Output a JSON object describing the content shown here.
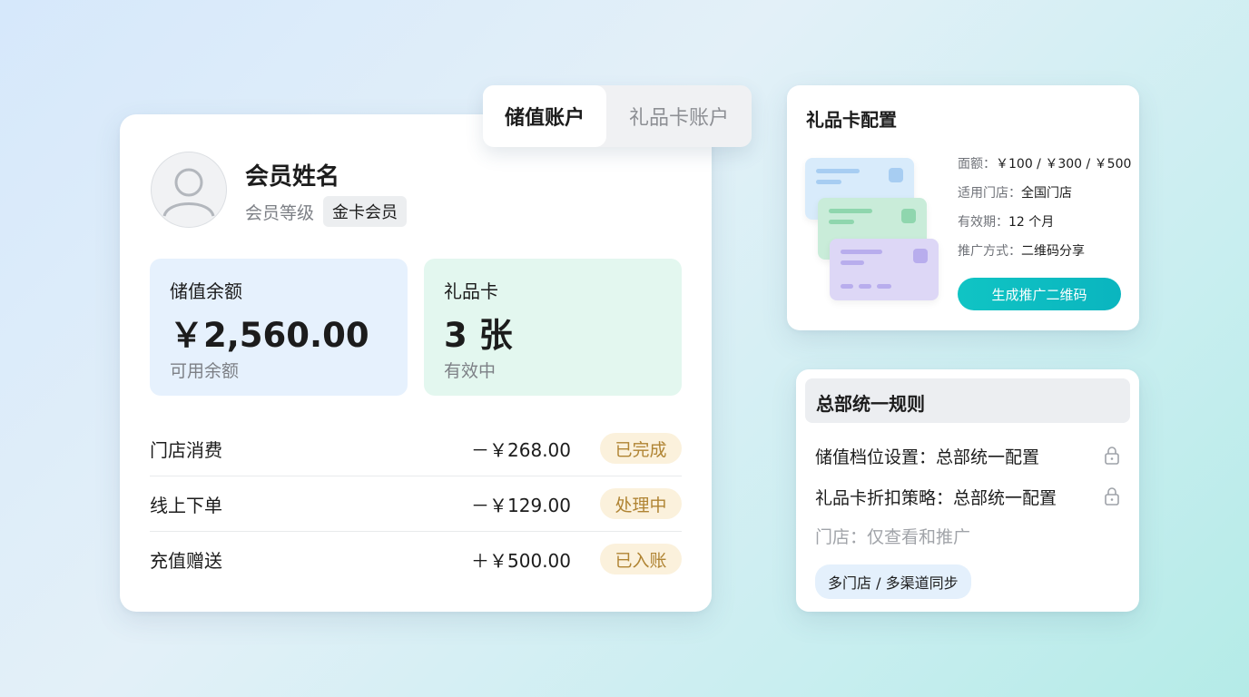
{
  "tabs": [
    {
      "label": "储值账户",
      "active": true
    },
    {
      "label": "礼品卡账户",
      "active": false
    }
  ],
  "member": {
    "name": "会员姓名",
    "level_label": "会员等级",
    "level_value": "金卡会员"
  },
  "stats": {
    "balance": {
      "title": "储值余额",
      "value": "￥2,560.00",
      "sub": "可用余额"
    },
    "giftcard": {
      "title": "礼品卡",
      "value": "3 张",
      "sub": "有效中"
    }
  },
  "transactions": [
    {
      "name": "门店消费",
      "amount": "－￥268.00",
      "status": "已完成"
    },
    {
      "name": "线上下单",
      "amount": "－￥129.00",
      "status": "处理中"
    },
    {
      "name": "充值赠送",
      "amount": "＋￥500.00",
      "status": "已入账"
    }
  ],
  "gift_config": {
    "title": "礼品卡配置",
    "lines": [
      {
        "label": "面额：",
        "value": "￥100 / ￥300 / ￥500"
      },
      {
        "label": "适用门店：",
        "value": "全国门店"
      },
      {
        "label": "有效期：",
        "value": "12 个月"
      },
      {
        "label": "推广方式：",
        "value": "二维码分享"
      }
    ],
    "button_label": "生成推广二维码"
  },
  "hq_rules": {
    "title": "总部统一规则",
    "rules": [
      {
        "text": "储值档位设置：总部统一配置",
        "icon": "lock-icon"
      },
      {
        "text": "礼品卡折扣策略：总部统一配置",
        "icon": "lock-icon"
      }
    ],
    "store_note": "门店：仅查看和推广",
    "sync_badge": "多门店 / 多渠道同步"
  },
  "colors": {
    "accent": "#10c4c4",
    "balance_bg": "#e6f1fd",
    "giftcard_bg": "#e3f7ef",
    "status_bg": "#fbf1dc",
    "status_text": "#b08433"
  }
}
